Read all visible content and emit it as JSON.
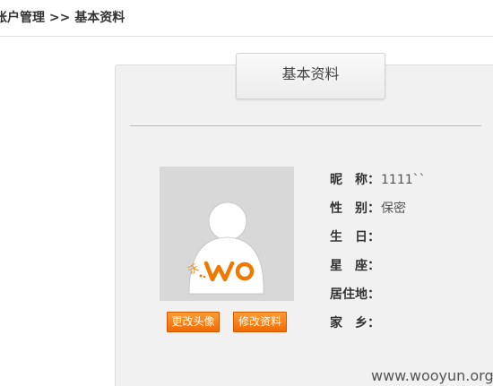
{
  "breadcrumb": "账户管理 >> 基本资料",
  "tab": {
    "label": "基本资料"
  },
  "profile": {
    "fields": [
      {
        "label": "昵　称：",
        "value": "1111``"
      },
      {
        "label": "性　别：",
        "value": "保密"
      },
      {
        "label": "生　日：",
        "value": ""
      },
      {
        "label": "星　座：",
        "value": ""
      },
      {
        "label": "居住地：",
        "value": ""
      },
      {
        "label": "家　乡：",
        "value": ""
      }
    ]
  },
  "buttons": {
    "change_avatar": "更改头像",
    "edit_profile": "修改资料"
  },
  "avatar_logo": "沃",
  "watermark": "www.wooyun.org",
  "colors": {
    "accent": "#f26a00",
    "panel_bg": "#f1f1f1",
    "avatar_bg": "#d8d8d8"
  }
}
